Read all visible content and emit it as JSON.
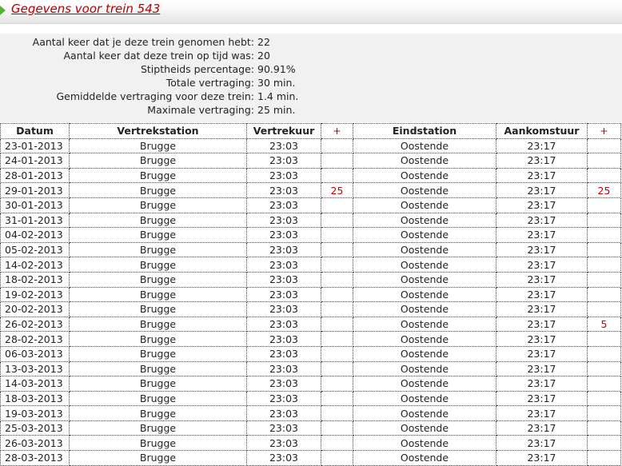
{
  "page": {
    "title": "Gegevens voor trein 543"
  },
  "stats": [
    {
      "label": "Aantal keer dat je deze trein genomen hebt:",
      "value": "22"
    },
    {
      "label": "Aantal keer dat deze trein op tijd was:",
      "value": "20"
    },
    {
      "label": "Stiptheids percentage:",
      "value": "90.91%"
    },
    {
      "label": "Totale vertraging:",
      "value": "30 min."
    },
    {
      "label": "Gemiddelde vertraging voor deze trein:",
      "value": "1.4 min."
    },
    {
      "label": "Maximale vertraging:",
      "value": "25 min."
    }
  ],
  "table": {
    "headers": [
      "Datum",
      "Vertrekstation",
      "Vertrekuur",
      "+",
      "Eindstation",
      "Aankomstuur",
      "+"
    ],
    "rows": [
      [
        "23-01-2013",
        "Brugge",
        "23:03",
        "",
        "Oostende",
        "23:17",
        ""
      ],
      [
        "24-01-2013",
        "Brugge",
        "23:03",
        "",
        "Oostende",
        "23:17",
        ""
      ],
      [
        "28-01-2013",
        "Brugge",
        "23:03",
        "",
        "Oostende",
        "23:17",
        ""
      ],
      [
        "29-01-2013",
        "Brugge",
        "23:03",
        "25",
        "Oostende",
        "23:17",
        "25"
      ],
      [
        "30-01-2013",
        "Brugge",
        "23:03",
        "",
        "Oostende",
        "23:17",
        ""
      ],
      [
        "31-01-2013",
        "Brugge",
        "23:03",
        "",
        "Oostende",
        "23:17",
        ""
      ],
      [
        "04-02-2013",
        "Brugge",
        "23:03",
        "",
        "Oostende",
        "23:17",
        ""
      ],
      [
        "05-02-2013",
        "Brugge",
        "23:03",
        "",
        "Oostende",
        "23:17",
        ""
      ],
      [
        "14-02-2013",
        "Brugge",
        "23:03",
        "",
        "Oostende",
        "23:17",
        ""
      ],
      [
        "18-02-2013",
        "Brugge",
        "23:03",
        "",
        "Oostende",
        "23:17",
        ""
      ],
      [
        "19-02-2013",
        "Brugge",
        "23:03",
        "",
        "Oostende",
        "23:17",
        ""
      ],
      [
        "20-02-2013",
        "Brugge",
        "23:03",
        "",
        "Oostende",
        "23:17",
        ""
      ],
      [
        "26-02-2013",
        "Brugge",
        "23:03",
        "",
        "Oostende",
        "23:17",
        "5"
      ],
      [
        "28-02-2013",
        "Brugge",
        "23:03",
        "",
        "Oostende",
        "23:17",
        ""
      ],
      [
        "06-03-2013",
        "Brugge",
        "23:03",
        "",
        "Oostende",
        "23:17",
        ""
      ],
      [
        "13-03-2013",
        "Brugge",
        "23:03",
        "",
        "Oostende",
        "23:17",
        ""
      ],
      [
        "14-03-2013",
        "Brugge",
        "23:03",
        "",
        "Oostende",
        "23:17",
        ""
      ],
      [
        "18-03-2013",
        "Brugge",
        "23:03",
        "",
        "Oostende",
        "23:17",
        ""
      ],
      [
        "19-03-2013",
        "Brugge",
        "23:03",
        "",
        "Oostende",
        "23:17",
        ""
      ],
      [
        "25-03-2013",
        "Brugge",
        "23:03",
        "",
        "Oostende",
        "23:17",
        ""
      ],
      [
        "26-03-2013",
        "Brugge",
        "23:03",
        "",
        "Oostende",
        "23:17",
        ""
      ],
      [
        "28-03-2013",
        "Brugge",
        "23:03",
        "",
        "Oostende",
        "23:17",
        ""
      ]
    ]
  },
  "colors": {
    "title": "#b40000",
    "delay": "#cc0000",
    "arrow": "#58b030"
  }
}
